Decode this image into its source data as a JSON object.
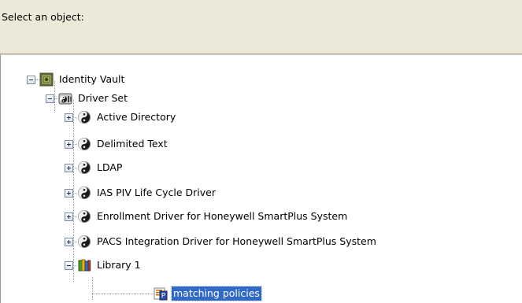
{
  "prompt_label": "Select an object:",
  "filter_value": "",
  "tree": {
    "identity_vault": {
      "label": "Identity Vault",
      "icon": "identity-vault-icon",
      "expanded": true
    },
    "driver_set": {
      "label": "Driver Set",
      "icon": "driver-set-icon",
      "expanded": true
    },
    "drivers": [
      {
        "label": "Active Directory",
        "icon": "yin-yang-driver-icon",
        "expanded": false
      },
      {
        "label": "Delimited Text",
        "icon": "yin-yang-driver-icon",
        "expanded": false
      },
      {
        "label": "LDAP",
        "icon": "yin-yang-driver-icon",
        "expanded": false
      },
      {
        "label": "IAS PIV Life Cycle Driver",
        "icon": "yin-yang-driver-icon",
        "expanded": false
      },
      {
        "label": "Enrollment Driver for Honeywell SmartPlus System",
        "icon": "yin-yang-driver-icon",
        "expanded": false
      },
      {
        "label": "PACS Integration Driver for Honeywell SmartPlus System",
        "icon": "yin-yang-driver-icon",
        "expanded": false
      }
    ],
    "library": {
      "label": "Library 1",
      "icon": "library-books-icon",
      "expanded": true
    },
    "policy": {
      "label": "matching policies",
      "icon": "policy-icon",
      "selected": true
    }
  },
  "colors": {
    "window_bg": "#ece9d8",
    "tree_bg": "#ffffff",
    "selection_bg": "#316ac5",
    "selection_text": "#ffffff"
  }
}
